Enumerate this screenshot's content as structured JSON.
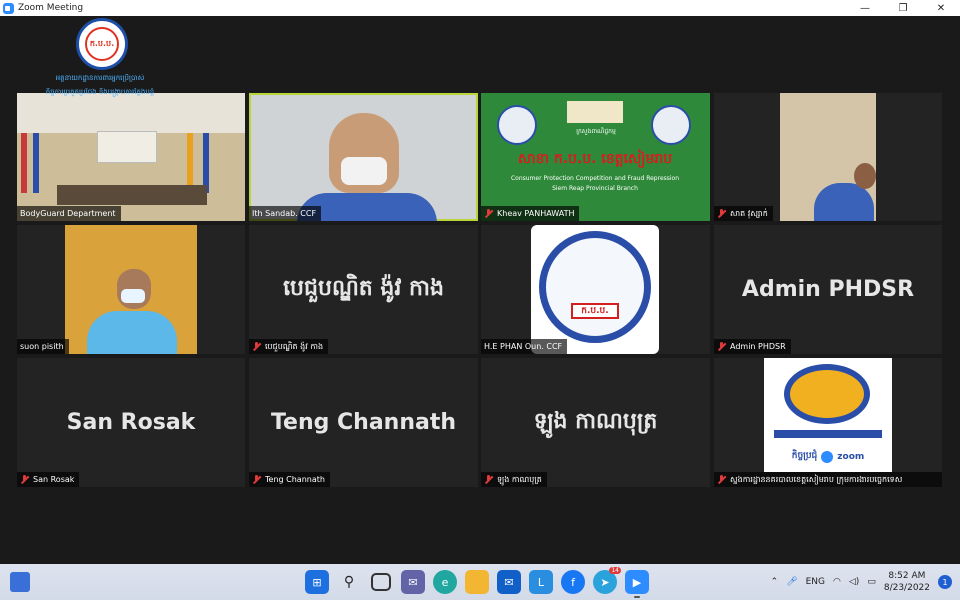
{
  "window": {
    "title": "Zoom Meeting",
    "controls": {
      "minimize": "—",
      "maximize": "❐",
      "close": "✕"
    }
  },
  "organization_logo": {
    "badge_text": "ក.ប.ប.",
    "org_text_line1": "អគ្គនាយកដ្ឋានការពារអ្នកប្រើប្រាស់",
    "org_text_line2": "កិច្ចការប្រកួតប្រជែង និងបង្ក្រាបការក្លែងបន្លំ"
  },
  "participants": [
    {
      "id": "bodyguard",
      "name": "BodyGuard Department",
      "muted": false,
      "video": true,
      "active_speaker": false
    },
    {
      "id": "ith-sandab",
      "name": "Ith Sandab. CCF",
      "muted": false,
      "video": true,
      "active_speaker": true
    },
    {
      "id": "kheav",
      "name": "Kheav PANHAWATH",
      "muted": true,
      "video": true,
      "active_speaker": false,
      "banner": {
        "title_kh": "សាខា ក.ប.ប. ខេត្តសៀមរាប",
        "ministry": "ក្រសួងពាណិជ្ជកម្ម",
        "subtitle_en1": "Consumer Protection Competition and Fraud Repression",
        "subtitle_en2": "Siem Reap Provincial Branch"
      }
    },
    {
      "id": "sath",
      "name": "សាត វុស្សាក់",
      "muted": true,
      "video": true,
      "active_speaker": false
    },
    {
      "id": "suon-pisith",
      "name": "suon pisith",
      "muted": false,
      "video": true,
      "active_speaker": false
    },
    {
      "id": "khmer-user",
      "name": "បេជួបណ្ឌិត ង៉ូវ កាង",
      "display_name": "បេជួបណ្ឌិត ង៉ូវ កាង",
      "muted": true,
      "video": false,
      "active_speaker": false
    },
    {
      "id": "phan",
      "name": "H.E PHAN Oun. CCF",
      "muted": false,
      "video": true,
      "active_speaker": false,
      "logo_text": "ក.ប.ប."
    },
    {
      "id": "admin-phdsr",
      "name": "Admin PHDSR",
      "display_name": "Admin PHDSR",
      "muted": true,
      "video": false,
      "active_speaker": false
    },
    {
      "id": "san-rosak",
      "name": "San Rosak",
      "display_name": "San Rosak",
      "muted": true,
      "video": false,
      "active_speaker": false
    },
    {
      "id": "teng-channath",
      "name": "Teng Channath",
      "display_name": "Teng Channath",
      "muted": true,
      "video": false,
      "active_speaker": false
    },
    {
      "id": "khmer-user2",
      "name": "ឡូង កាណបុត្រ",
      "display_name": "ឡូង កាណបុត្រ",
      "muted": true,
      "video": false,
      "active_speaker": false
    },
    {
      "id": "zoom-user",
      "name": "ស្នងការដ្ឋាននគរបាលខេត្តសៀមរាប ក្រុមការងារបច្ចេកទេស",
      "muted": true,
      "video": true,
      "active_speaker": false,
      "logo_caption": "កិច្ចប្រជុំ",
      "zoom_label": "zoom"
    }
  ],
  "taskbar": {
    "language": "ENG",
    "time": "8:52 AM",
    "date": "8/23/2022",
    "notification_count": "1",
    "telegram_badge": "14",
    "apps": [
      "windows-start-icon",
      "search-icon",
      "task-view-icon",
      "chat-icon",
      "edge-icon",
      "file-explorer-icon",
      "mail-icon",
      "l-app-icon",
      "facebook-icon",
      "telegram-icon",
      "zoom-icon"
    ]
  },
  "colors": {
    "active_speaker_border": "#b9d53a",
    "mute_red": "#e03a3a",
    "tile_bg": "#232323",
    "zoom_blue": "#2d8cff"
  }
}
